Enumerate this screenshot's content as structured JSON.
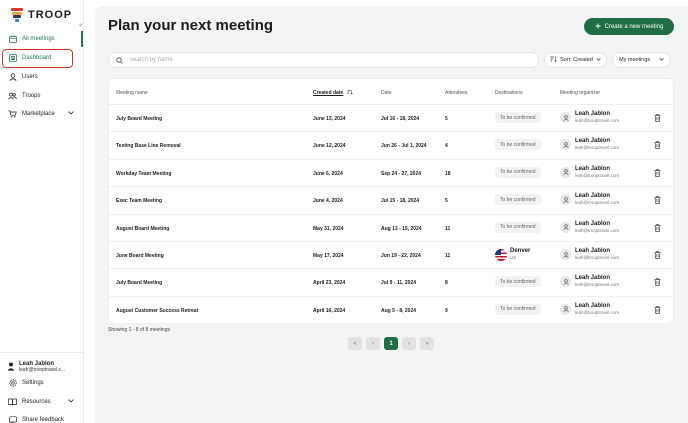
{
  "brand": {
    "name": "TROOP",
    "accent": "#1f6e45",
    "logo_colors": [
      "#d9362b",
      "#f0a33b",
      "#2b3a67",
      "#3b7dd8"
    ]
  },
  "sidebar": {
    "collapse_icon": "double-chevron-left",
    "items": [
      {
        "label": "All meetings",
        "icon": "calendar-icon"
      },
      {
        "label": "Dashboard",
        "icon": "dashboard-icon"
      },
      {
        "label": "Users",
        "icon": "user-icon"
      },
      {
        "label": "Troops",
        "icon": "group-icon"
      },
      {
        "label": "Marketplace",
        "icon": "cart-icon"
      }
    ],
    "user": {
      "name": "Leah Jablon",
      "email": "leah@trooptravel.c..."
    },
    "bottom_items": [
      {
        "label": "Settings",
        "icon": "gear-icon"
      },
      {
        "label": "Resources",
        "icon": "book-icon"
      },
      {
        "label": "Share feedback",
        "icon": "feedback-icon"
      }
    ]
  },
  "header": {
    "title": "Plan your next meeting",
    "create_label": "Create a new meeting"
  },
  "filters": {
    "search_placeholder": "Search by name",
    "search_value": "",
    "sort_label": "Sort: Created",
    "mine_label": "My meetings"
  },
  "table": {
    "headers": {
      "name": "Meeting name",
      "created": "Created date",
      "date": "Date",
      "attendees": "Attendees",
      "destinations": "Destinations",
      "organizer": "Meeting organizer"
    },
    "rows": [
      {
        "name": "July Board Meeting",
        "created": "June 13, 2024",
        "date": "Jul 16 - 18, 2024",
        "attendees": "5",
        "destination": "To be confirmed",
        "organizer": "Leah Jablon",
        "email": "leah@trooptravel.com"
      },
      {
        "name": "Testing Base Line Removal",
        "created": "June 12, 2024",
        "date": "Jun 26 - Jul 1, 2024",
        "attendees": "4",
        "destination": "To be confirmed",
        "organizer": "Leah Jablon",
        "email": "leah@trooptravel.com"
      },
      {
        "name": "Workday Team Meeting",
        "created": "June 6, 2024",
        "date": "Sep 24 - 27, 2024",
        "attendees": "18",
        "destination": "To be confirmed",
        "organizer": "Leah Jablon",
        "email": "leah@trooptravel.com"
      },
      {
        "name": "Exec Team Meeting",
        "created": "June 4, 2024",
        "date": "Jul 15 - 18, 2024",
        "attendees": "5",
        "destination": "To be confirmed",
        "organizer": "Leah Jablon",
        "email": "leah@trooptravel.com"
      },
      {
        "name": "August Board Meeting",
        "created": "May 31, 2024",
        "date": "Aug 13 - 15, 2024",
        "attendees": "11",
        "destination": "To be confirmed",
        "organizer": "Leah Jablon",
        "email": "leah@trooptravel.com"
      },
      {
        "name": "June Board Meeting",
        "created": "May 17, 2024",
        "date": "Jun 19 - 22, 2024",
        "attendees": "11",
        "destination": "Denver",
        "dest_code": "US",
        "organizer": "Leah Jablon",
        "email": "leah@trooptravel.com"
      },
      {
        "name": "July Board Meeting",
        "created": "April 23, 2024",
        "date": "Jul 9 - 11, 2024",
        "attendees": "8",
        "destination": "To be confirmed",
        "organizer": "Leah Jablon",
        "email": "leah@trooptravel.com"
      },
      {
        "name": "August Customer Success Retreat",
        "created": "April 16, 2024",
        "date": "Aug 5 - 8, 2024",
        "attendees": "9",
        "destination": "To be confirmed",
        "organizer": "Leah Jablon",
        "email": "leah@trooptravel.com"
      }
    ]
  },
  "pagination": {
    "showing": "Showing 1 - 8 of 8 meetings",
    "first": "«",
    "prev": "‹",
    "current": "1",
    "next": "›",
    "last": "»"
  }
}
